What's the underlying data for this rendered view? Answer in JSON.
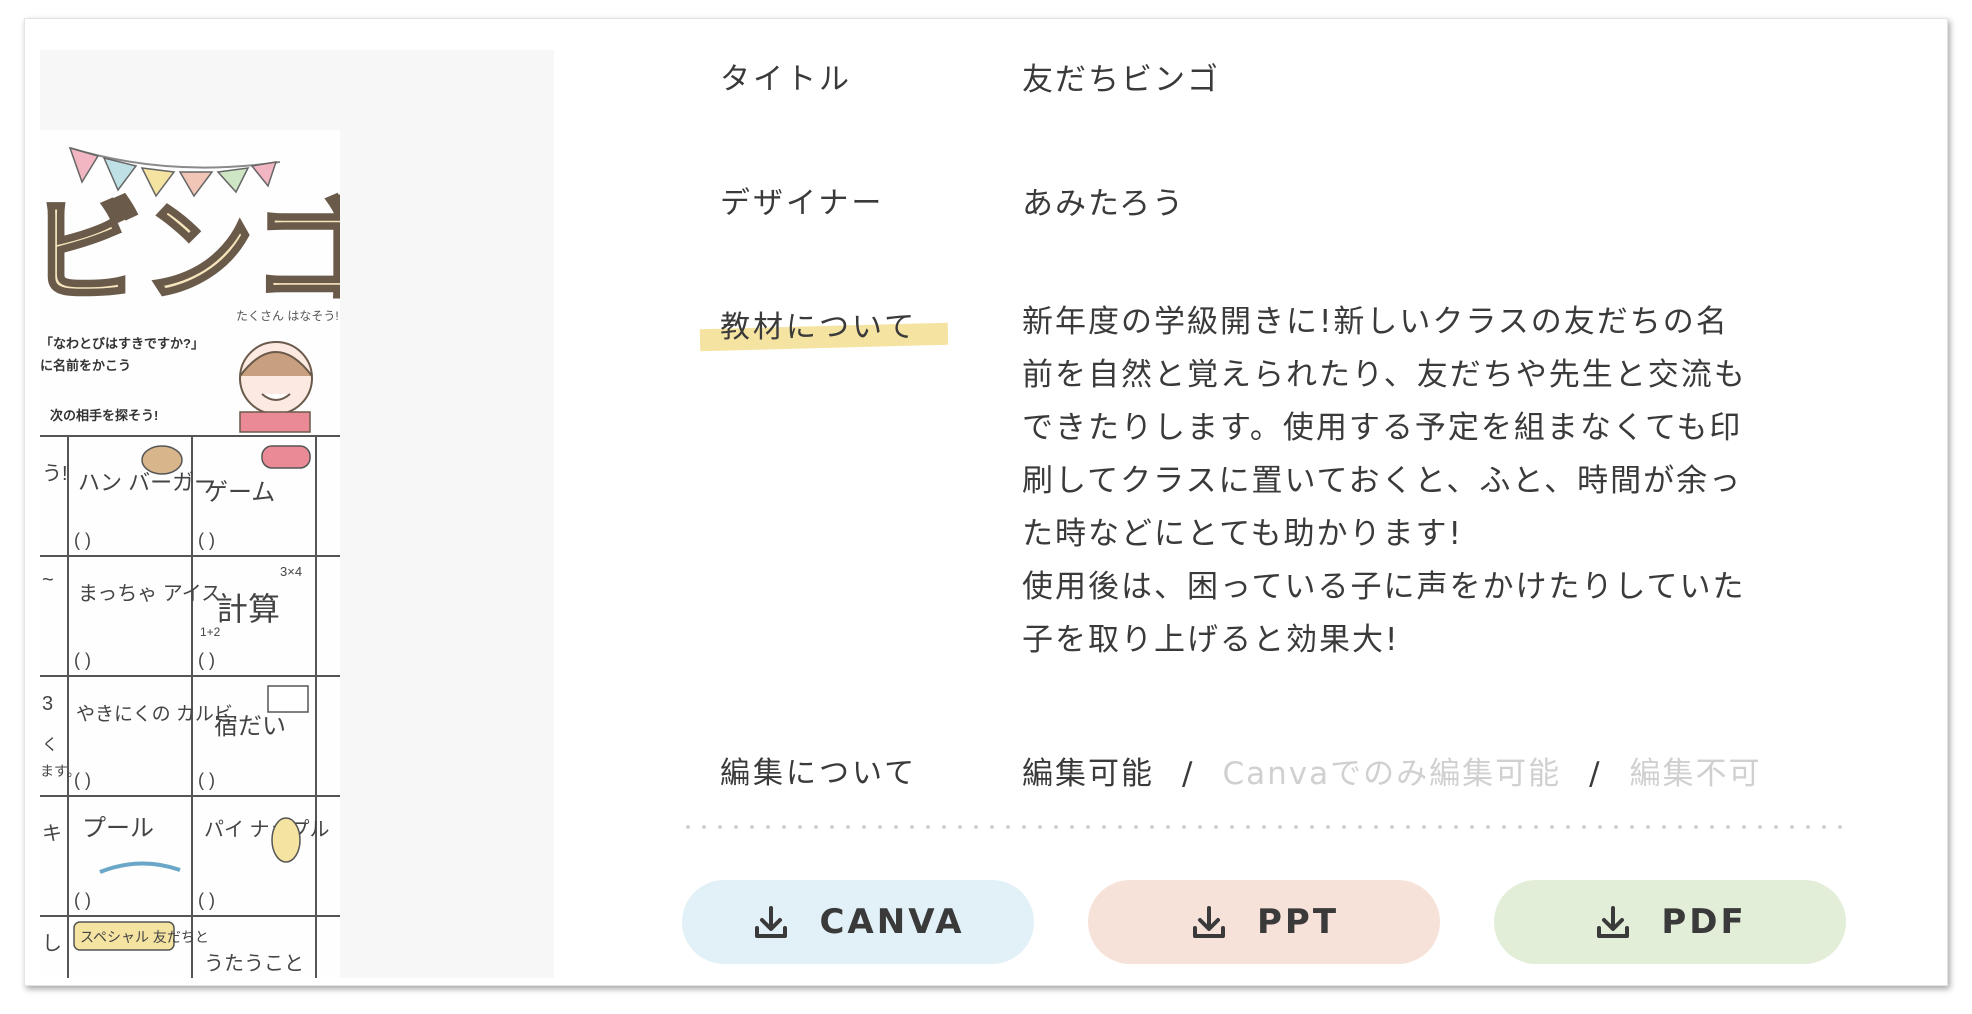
{
  "thumbnail": {
    "title": "ビンゴ",
    "bubble": "たくさん はなそう!",
    "question": "「なわとびはすきですか?」",
    "line2": "に名前をかこう",
    "line3": "次の相手を探そう!",
    "left_fragments": [
      "う!",
      "~",
      "3",
      "く",
      "ます。",
      "キ",
      "し"
    ],
    "cells": [
      [
        "ハン バーガー",
        "ゲーム"
      ],
      [
        "まっちゃ アイス",
        "計算"
      ],
      [
        "やきにくの カルビ",
        "宿だい"
      ],
      [
        "プール",
        "パイ ナップル"
      ],
      [
        "スペシャル 友だちと",
        "うたうこと"
      ]
    ],
    "paren": "(     )",
    "math_small": "3×4",
    "math_small2": "1+2"
  },
  "details": {
    "title_label": "タイトル",
    "title_value": "友だちビンゴ",
    "designer_label": "デザイナー",
    "designer_value": "あみたろう",
    "about_label": "教材について",
    "about_value": "新年度の学級開きに!新しいクラスの友だちの名\n前を自然と覚えられたり、友だちや先生と交流も\nできたりします。使用する予定を組まなくても印\n刷してクラスに置いておくと、ふと、時間が余っ\nた時などにとても助かります!\n使用後は、困っている子に声をかけたりしていた\n子を取り上げると効果大!",
    "edit_label": "編集について",
    "edit_options": [
      "編集可能",
      "Canvaでのみ編集可能",
      "編集不可"
    ],
    "edit_sep": "/"
  },
  "downloads": [
    {
      "label": "CANVA",
      "color": "#e2f1f7",
      "icon": "download-icon"
    },
    {
      "label": "PPT",
      "color": "#f7e2da",
      "icon": "download-icon"
    },
    {
      "label": "PDF",
      "color": "#e3eed9",
      "icon": "download-icon"
    }
  ]
}
